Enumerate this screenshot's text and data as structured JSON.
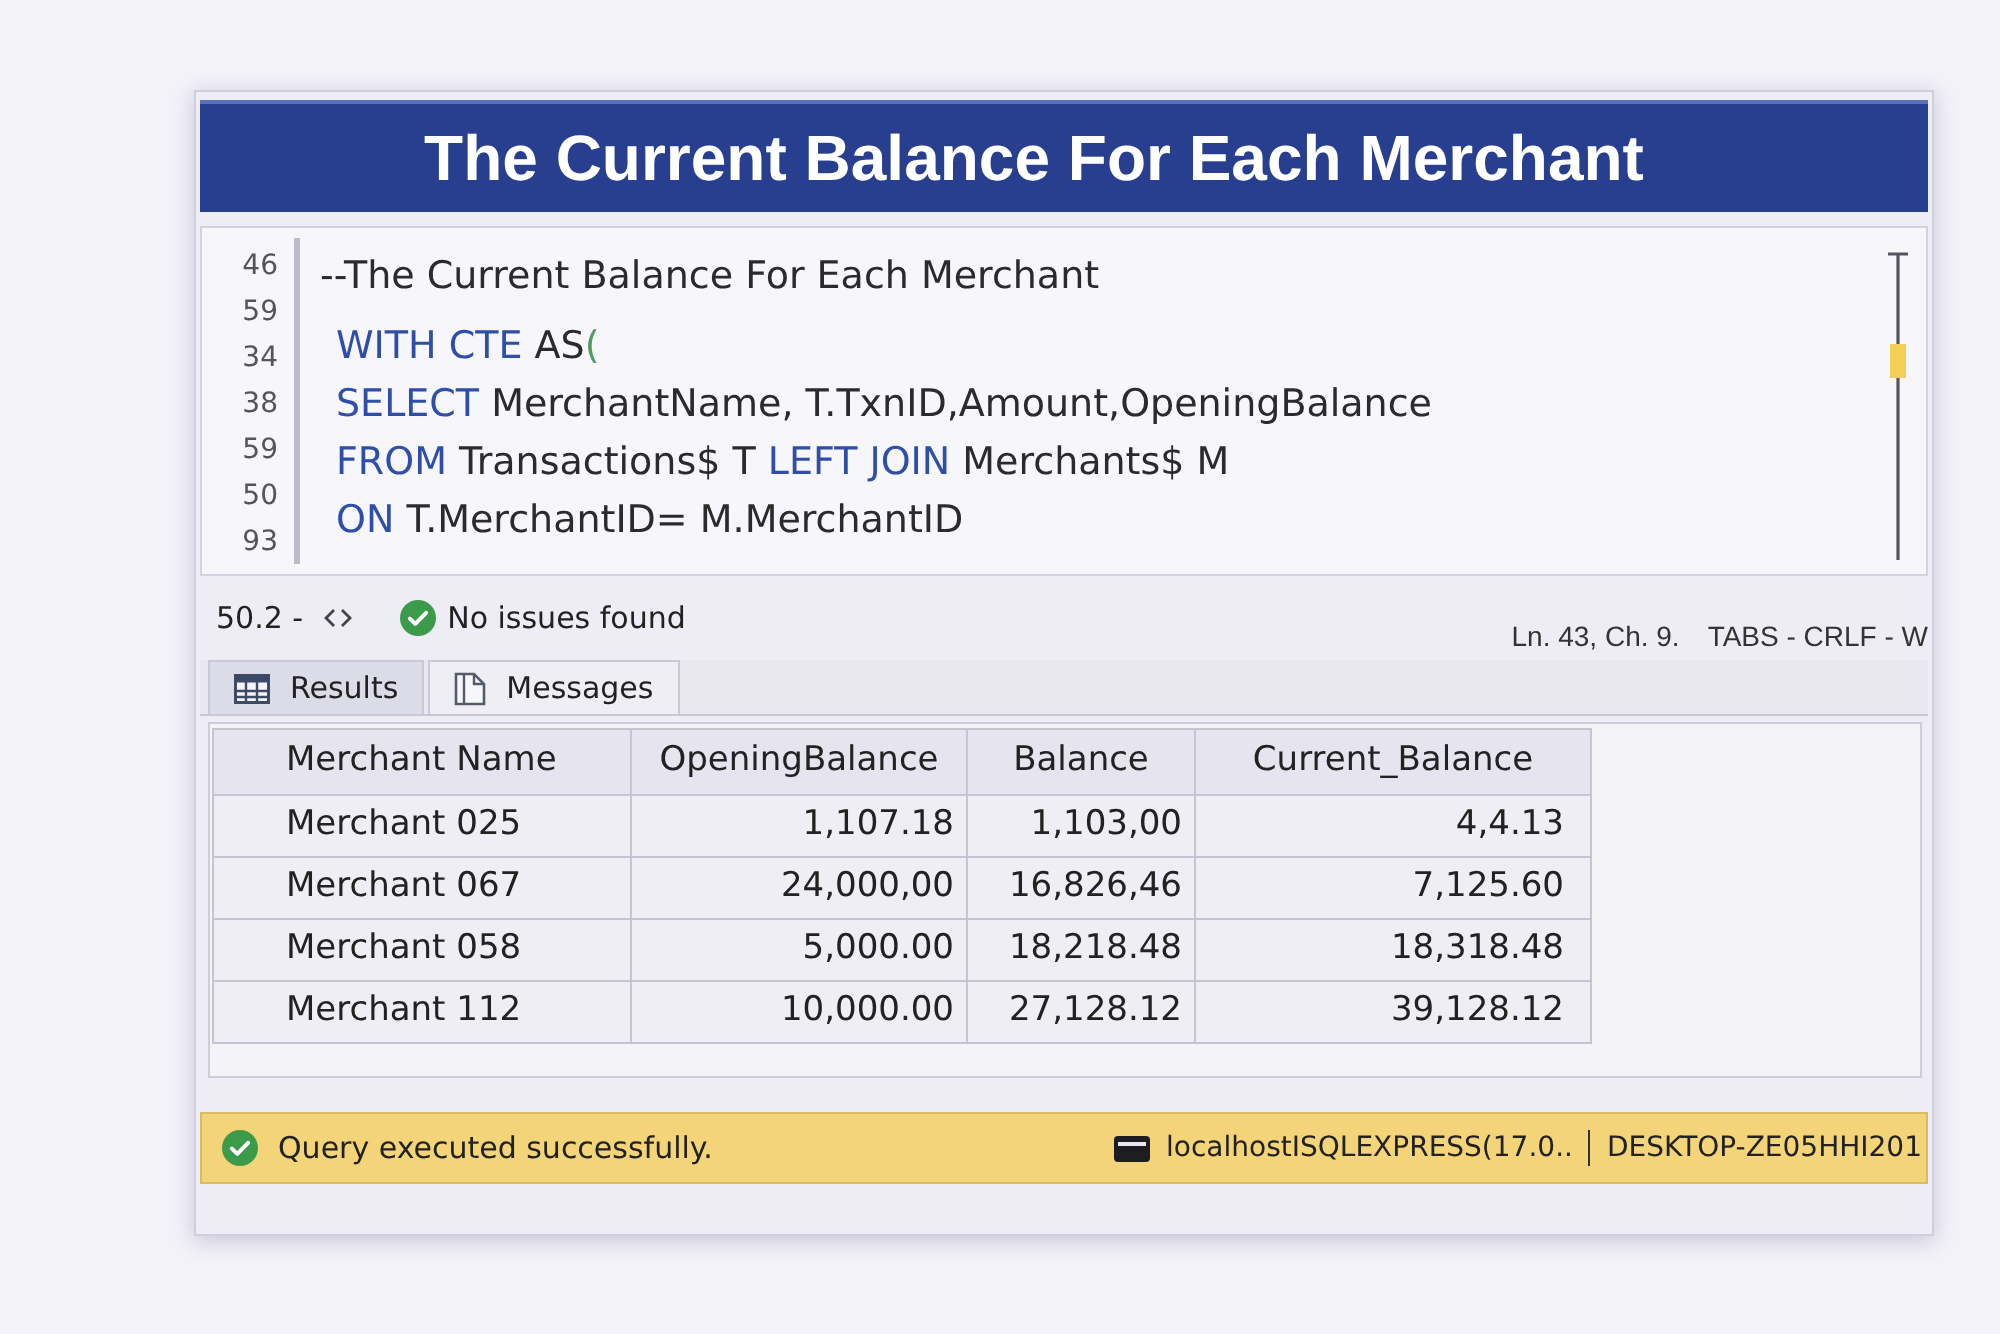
{
  "panel": {
    "title": "The Current Balance For Each Merchant"
  },
  "editor": {
    "line_numbers": [
      "46",
      "59",
      "34",
      "38",
      "59",
      "50",
      "93"
    ],
    "lines": [
      {
        "kind": "comment",
        "tokens": [
          {
            "kind": "comment",
            "text": "--The Current Balance For Each Merchant"
          }
        ]
      },
      {
        "kind": "code",
        "tokens": [
          {
            "kind": "keyword",
            "text": "WITH CTE"
          },
          {
            "kind": "text",
            "text": " AS"
          },
          {
            "kind": "paren",
            "text": "("
          }
        ]
      },
      {
        "kind": "code",
        "tokens": [
          {
            "kind": "keyword",
            "text": "SELECT"
          },
          {
            "kind": "text",
            "text": " MerchantName, T.TxnID,Amount,OpeningBalance"
          }
        ]
      },
      {
        "kind": "code",
        "tokens": [
          {
            "kind": "keyword",
            "text": "FROM"
          },
          {
            "kind": "text",
            "text": " Transactions$ T "
          },
          {
            "kind": "keyword",
            "text": "LEFT JOIN"
          },
          {
            "kind": "text",
            "text": " Merchants$ M"
          }
        ]
      },
      {
        "kind": "code",
        "tokens": [
          {
            "kind": "keyword",
            "text": "ON"
          },
          {
            "kind": "text",
            "text": " T.MerchantID= M.MerchantID"
          }
        ]
      }
    ]
  },
  "status_row": {
    "zoom": "50.2 -",
    "issues": "No issues found",
    "position": "Ln. 43, Ch. 9.",
    "format": "TABS - CRLF - W"
  },
  "result_tabs": [
    {
      "kind": "grid",
      "label": "Results",
      "selected": true
    },
    {
      "kind": "messages",
      "label": "Messages",
      "selected": false
    }
  ],
  "table": {
    "columns": [
      "Merchant Name",
      "OpeningBalance",
      "Balance",
      "Current_Balance"
    ],
    "rows": [
      [
        "Merchant 025",
        "1,107.18",
        "1,103,00",
        "4,4.13"
      ],
      [
        "Merchant 067",
        "24,000,00",
        "16,826,46",
        "7,125.60"
      ],
      [
        "Merchant 058",
        "5,000.00",
        "18,218.48",
        "18,318.48"
      ],
      [
        "Merchant 112",
        "10,000.00",
        "27,128.12",
        "39,128.12"
      ]
    ]
  },
  "status_bar": {
    "message": "Query executed successfully.",
    "server": "localhostISQLEXPRESS(17.0..",
    "machine": "DESKTOP-ZE05HHI201"
  }
}
